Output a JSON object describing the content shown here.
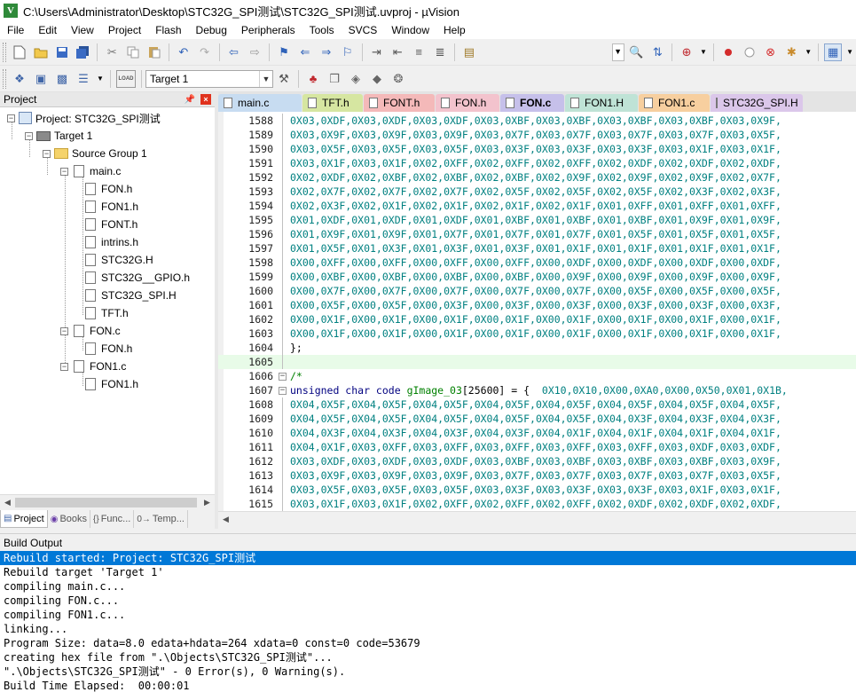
{
  "window": {
    "title": "C:\\Users\\Administrator\\Desktop\\STC32G_SPI测试\\STC32G_SPI测试.uvproj - µVision",
    "app_icon_letter": "V"
  },
  "menu": [
    "File",
    "Edit",
    "View",
    "Project",
    "Flash",
    "Debug",
    "Peripherals",
    "Tools",
    "SVCS",
    "Window",
    "Help"
  ],
  "toolbar": {
    "target_select": "Target 1",
    "load_label": "LOAD"
  },
  "project_panel": {
    "title": "Project",
    "tree": [
      {
        "label": "Project: STC32G_SPI测试",
        "level": 0,
        "kind": "proj",
        "expanded": true
      },
      {
        "label": "Target 1",
        "level": 1,
        "kind": "target",
        "expanded": true
      },
      {
        "label": "Source Group 1",
        "level": 2,
        "kind": "folder",
        "expanded": true
      },
      {
        "label": "main.c",
        "level": 3,
        "kind": "file",
        "expanded": true
      },
      {
        "label": "FON.h",
        "level": 4,
        "kind": "file"
      },
      {
        "label": "FON1.h",
        "level": 4,
        "kind": "file"
      },
      {
        "label": "FONT.h",
        "level": 4,
        "kind": "file"
      },
      {
        "label": "intrins.h",
        "level": 4,
        "kind": "file"
      },
      {
        "label": "STC32G.H",
        "level": 4,
        "kind": "file"
      },
      {
        "label": "STC32G__GPIO.h",
        "level": 4,
        "kind": "file"
      },
      {
        "label": "STC32G_SPI.H",
        "level": 4,
        "kind": "file"
      },
      {
        "label": "TFT.h",
        "level": 4,
        "kind": "file"
      },
      {
        "label": "FON.c",
        "level": 3,
        "kind": "file",
        "expanded": true
      },
      {
        "label": "FON.h",
        "level": 4,
        "kind": "file"
      },
      {
        "label": "FON1.c",
        "level": 3,
        "kind": "file",
        "expanded": true
      },
      {
        "label": "FON1.h",
        "level": 4,
        "kind": "file"
      }
    ],
    "tabs": [
      {
        "label": "Project",
        "icon": "project-tab-icon"
      },
      {
        "label": "Books",
        "icon": "books-icon"
      },
      {
        "label": "Func...",
        "icon": "braces-icon",
        "glyph": "{}"
      },
      {
        "label": "Temp...",
        "icon": "template-icon",
        "glyph": "0→"
      }
    ]
  },
  "editor_tabs": [
    {
      "label": "main.c",
      "color": "#c7dcf1"
    },
    {
      "label": "TFT.h",
      "color": "#d6e6a1"
    },
    {
      "label": "FONT.h",
      "color": "#f4b9b9"
    },
    {
      "label": "FON.h",
      "color": "#f3c3cd"
    },
    {
      "label": "FON.c",
      "color": "#c6c0ea",
      "active": true
    },
    {
      "label": "FON1.H",
      "color": "#bfe3d6"
    },
    {
      "label": "FON1.c",
      "color": "#f7cf9f"
    },
    {
      "label": "STC32G_SPI.H",
      "color": "#dbc7ea"
    }
  ],
  "code_lines": [
    {
      "n": "1588",
      "text": "0X03,0XDF,0X03,0XDF,0X03,0XDF,0X03,0XBF,0X03,0XBF,0X03,0XBF,0X03,0XBF,0X03,0X9F,"
    },
    {
      "n": "1589",
      "text": "0X03,0X9F,0X03,0X9F,0X03,0X9F,0X03,0X7F,0X03,0X7F,0X03,0X7F,0X03,0X7F,0X03,0X5F,"
    },
    {
      "n": "1590",
      "text": "0X03,0X5F,0X03,0X5F,0X03,0X5F,0X03,0X3F,0X03,0X3F,0X03,0X3F,0X03,0X1F,0X03,0X1F,"
    },
    {
      "n": "1591",
      "text": "0X03,0X1F,0X03,0X1F,0X02,0XFF,0X02,0XFF,0X02,0XFF,0X02,0XDF,0X02,0XDF,0X02,0XDF,"
    },
    {
      "n": "1592",
      "text": "0X02,0XDF,0X02,0XBF,0X02,0XBF,0X02,0XBF,0X02,0X9F,0X02,0X9F,0X02,0X9F,0X02,0X7F,"
    },
    {
      "n": "1593",
      "text": "0X02,0X7F,0X02,0X7F,0X02,0X7F,0X02,0X5F,0X02,0X5F,0X02,0X5F,0X02,0X3F,0X02,0X3F,"
    },
    {
      "n": "1594",
      "text": "0X02,0X3F,0X02,0X1F,0X02,0X1F,0X02,0X1F,0X02,0X1F,0X01,0XFF,0X01,0XFF,0X01,0XFF,"
    },
    {
      "n": "1595",
      "text": "0X01,0XDF,0X01,0XDF,0X01,0XDF,0X01,0XBF,0X01,0XBF,0X01,0XBF,0X01,0X9F,0X01,0X9F,"
    },
    {
      "n": "1596",
      "text": "0X01,0X9F,0X01,0X9F,0X01,0X7F,0X01,0X7F,0X01,0X7F,0X01,0X5F,0X01,0X5F,0X01,0X5F,"
    },
    {
      "n": "1597",
      "text": "0X01,0X5F,0X01,0X3F,0X01,0X3F,0X01,0X3F,0X01,0X1F,0X01,0X1F,0X01,0X1F,0X01,0X1F,"
    },
    {
      "n": "1598",
      "text": "0X00,0XFF,0X00,0XFF,0X00,0XFF,0X00,0XFF,0X00,0XDF,0X00,0XDF,0X00,0XDF,0X00,0XDF,"
    },
    {
      "n": "1599",
      "text": "0X00,0XBF,0X00,0XBF,0X00,0XBF,0X00,0XBF,0X00,0X9F,0X00,0X9F,0X00,0X9F,0X00,0X9F,"
    },
    {
      "n": "1600",
      "text": "0X00,0X7F,0X00,0X7F,0X00,0X7F,0X00,0X7F,0X00,0X7F,0X00,0X5F,0X00,0X5F,0X00,0X5F,"
    },
    {
      "n": "1601",
      "text": "0X00,0X5F,0X00,0X5F,0X00,0X3F,0X00,0X3F,0X00,0X3F,0X00,0X3F,0X00,0X3F,0X00,0X3F,"
    },
    {
      "n": "1602",
      "text": "0X00,0X1F,0X00,0X1F,0X00,0X1F,0X00,0X1F,0X00,0X1F,0X00,0X1F,0X00,0X1F,0X00,0X1F,"
    },
    {
      "n": "1603",
      "text": "0X00,0X1F,0X00,0X1F,0X00,0X1F,0X00,0X1F,0X00,0X1F,0X00,0X1F,0X00,0X1F,0X00,0X1F,"
    },
    {
      "n": "1604",
      "text": "};"
    },
    {
      "n": "1605",
      "text": ""
    },
    {
      "n": "1606",
      "text": "/*"
    },
    {
      "n": "1607",
      "text": "unsigned char code gImage_03[25600] = {  0X10,0X10,0X00,0XA0,0X00,0X50,0X01,0X1B,"
    },
    {
      "n": "1608",
      "text": "0X04,0X5F,0X04,0X5F,0X04,0X5F,0X04,0X5F,0X04,0X5F,0X04,0X5F,0X04,0X5F,0X04,0X5F,"
    },
    {
      "n": "1609",
      "text": "0X04,0X5F,0X04,0X5F,0X04,0X5F,0X04,0X5F,0X04,0X5F,0X04,0X3F,0X04,0X3F,0X04,0X3F,"
    },
    {
      "n": "1610",
      "text": "0X04,0X3F,0X04,0X3F,0X04,0X3F,0X04,0X3F,0X04,0X1F,0X04,0X1F,0X04,0X1F,0X04,0X1F,"
    },
    {
      "n": "1611",
      "text": "0X04,0X1F,0X03,0XFF,0X03,0XFF,0X03,0XFF,0X03,0XFF,0X03,0XFF,0X03,0XDF,0X03,0XDF,"
    },
    {
      "n": "1612",
      "text": "0X03,0XDF,0X03,0XDF,0X03,0XDF,0X03,0XBF,0X03,0XBF,0X03,0XBF,0X03,0XBF,0X03,0X9F,"
    },
    {
      "n": "1613",
      "text": "0X03,0X9F,0X03,0X9F,0X03,0X9F,0X03,0X7F,0X03,0X7F,0X03,0X7F,0X03,0X7F,0X03,0X5F,"
    },
    {
      "n": "1614",
      "text": "0X03,0X5F,0X03,0X5F,0X03,0X5F,0X03,0X3F,0X03,0X3F,0X03,0X3F,0X03,0X1F,0X03,0X1F,"
    },
    {
      "n": "1615",
      "text": "0X03,0X1F,0X03,0X1F,0X02,0XFF,0X02,0XFF,0X02,0XFF,0X02,0XDF,0X02,0XDF,0X02,0XDF,"
    }
  ],
  "build_output": {
    "title": "Build Output",
    "lines": [
      "Rebuild started: Project: STC32G_SPI测试",
      "Rebuild target 'Target 1'",
      "compiling main.c...",
      "compiling FON.c...",
      "compiling FON1.c...",
      "linking...",
      "Program Size: data=8.0 edata+hdata=264 xdata=0 const=0 code=53679",
      "creating hex file from \".\\Objects\\STC32G_SPI测试\"...",
      "\".\\Objects\\STC32G_SPI测试\" - 0 Error(s), 0 Warning(s).",
      "Build Time Elapsed:  00:00:01"
    ]
  }
}
